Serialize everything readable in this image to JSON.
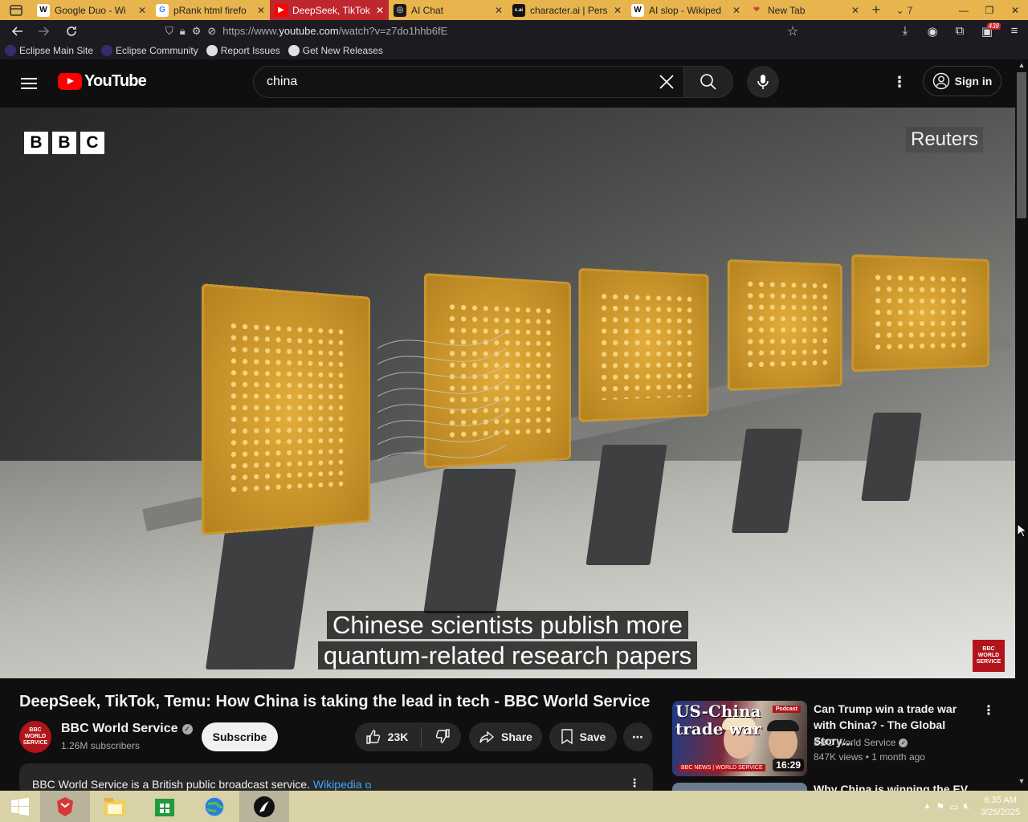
{
  "browser": {
    "tabs": [
      {
        "title": "Google Duo - Wi",
        "favicon": "W",
        "fav_bg": "#ffffff",
        "fav_fg": "#000000",
        "active": false
      },
      {
        "title": "pRank html firefo",
        "favicon": "G",
        "fav_bg": "#ffffff",
        "fav_fg": "#4285f4",
        "active": false
      },
      {
        "title": "DeepSeek, TikTok",
        "favicon": "▶",
        "fav_bg": "#ff0000",
        "fav_fg": "#ffffff",
        "active": true
      },
      {
        "title": "AI Chat",
        "favicon": "◎",
        "fav_bg": "#1a1a1a",
        "fav_fg": "#ffffff",
        "active": false
      },
      {
        "title": "character.ai | Pers",
        "favicon": "c.ai",
        "fav_bg": "#111111",
        "fav_fg": "#ffffff",
        "active": false
      },
      {
        "title": "AI slop - Wikiped",
        "favicon": "W",
        "fav_bg": "#ffffff",
        "fav_fg": "#000000",
        "active": false
      },
      {
        "title": "New Tab",
        "favicon": "❤",
        "fav_bg": "transparent",
        "fav_fg": "#d43a3a",
        "active": false
      }
    ],
    "tab_count": "7",
    "url_prefix": "https://www.",
    "url_host": "youtube.com",
    "url_path": "/watch?v=z7do1hhb6fE",
    "extensions_badge": "438",
    "bookmarks": [
      {
        "label": "Eclipse Main Site",
        "icon_color": "#3b2a6b"
      },
      {
        "label": "Eclipse Community",
        "icon_color": "#3b2a6b"
      },
      {
        "label": "Report Issues",
        "icon_color": "#e0e0e0"
      },
      {
        "label": "Get New Releases",
        "icon_color": "#e0e0e0"
      }
    ]
  },
  "youtube": {
    "logo_text": "YouTube",
    "search_value": "china",
    "sign_in": "Sign in",
    "video": {
      "watermark_bbc": [
        "B",
        "B",
        "C"
      ],
      "watermark_reuters": "Reuters",
      "caption_line1": "Chinese scientists publish more",
      "caption_line2": "quantum-related research papers",
      "corner_logo": "BBC WORLD SERVICE"
    },
    "title": "DeepSeek, TikTok, Temu: How China is taking the lead in tech - BBC World Service",
    "channel": {
      "name": "BBC World Service",
      "avatar_text": "BBC WORLD SERVICE",
      "subscribers": "1.26M subscribers",
      "subscribe_label": "Subscribe"
    },
    "actions": {
      "likes": "23K",
      "share": "Share",
      "save": "Save"
    },
    "description": {
      "text": "BBC World Service is a British public broadcast service.",
      "link": "Wikipedia"
    },
    "recommended": [
      {
        "thumb_text": "US-China trade war",
        "thumb_badge": "Podcast",
        "thumb_brand": "BBC NEWS | WORLD SERVICE",
        "duration": "16:29",
        "title": "Can Trump win a trade war with China? - The Global Story…",
        "channel": "BBC World Service",
        "views": "847K views",
        "age": "1 month ago"
      },
      {
        "title": "Why China is winning the EV"
      }
    ]
  },
  "taskbar": {
    "time": "6:35 AM",
    "date": "3/25/2025"
  },
  "colors": {
    "tab_strip": "#e8b44e",
    "active_tab": "#c0262d",
    "yt_bg": "#0f0f0f",
    "link": "#3ea6ff",
    "taskbar": "#d8d2a6"
  }
}
